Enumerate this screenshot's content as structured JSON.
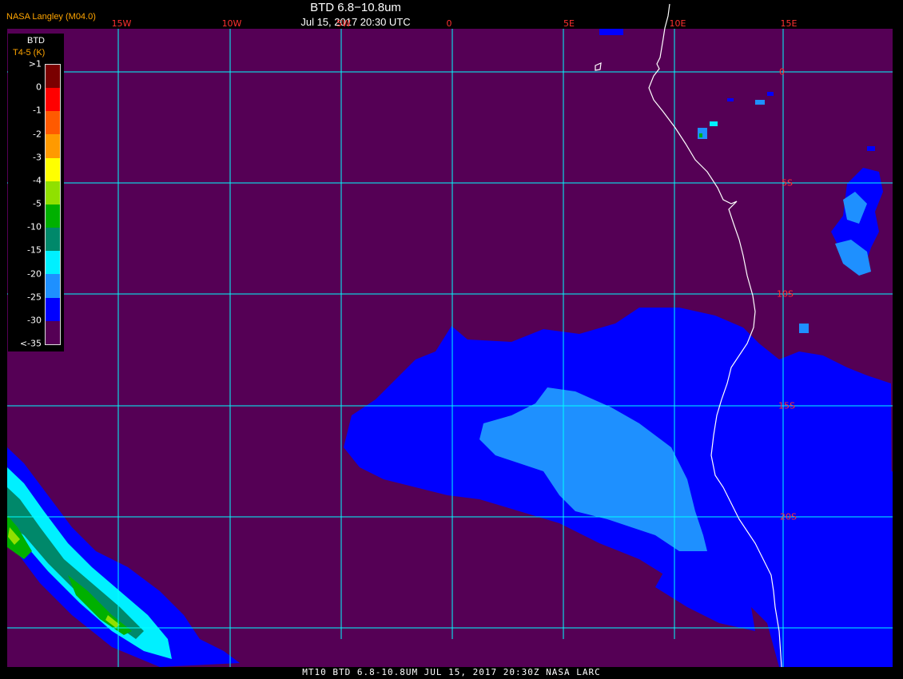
{
  "header": {
    "title": "BTD 6.8−10.8um",
    "subtitle": "Jul 15, 2017 20:30 UTC",
    "credit": "NASA Langley (M04.0)"
  },
  "grid": {
    "lon_labels": [
      "15W",
      "10W",
      "5W",
      "0",
      "5E",
      "10E",
      "15E"
    ],
    "lat_labels": [
      "0",
      "5S",
      "10S",
      "15S",
      "20S"
    ]
  },
  "legend": {
    "title": "BTD",
    "units": "T4-5 (K)",
    "ticks": [
      ">1",
      "0",
      "-1",
      "-2",
      "-3",
      "-4",
      "-5",
      "-10",
      "-15",
      "-20",
      "-25",
      "-30",
      "<-35"
    ],
    "colors": [
      "#7a0000",
      "#ff0000",
      "#ff5a00",
      "#ff9a00",
      "#ffff00",
      "#90e000",
      "#00b000",
      "#00886a",
      "#00f0ff",
      "#1e90ff",
      "#0000ff",
      "#550055"
    ]
  },
  "footer": "MT10  BTD 6.8-10.8UM   JUL 15, 2017 20:30Z   NASA LARC",
  "colors": {
    "background": "#550055",
    "grid": "#00ffff",
    "coastline": "#ffffff",
    "grid_label": "#ff3030",
    "credit": "#ffa500"
  }
}
